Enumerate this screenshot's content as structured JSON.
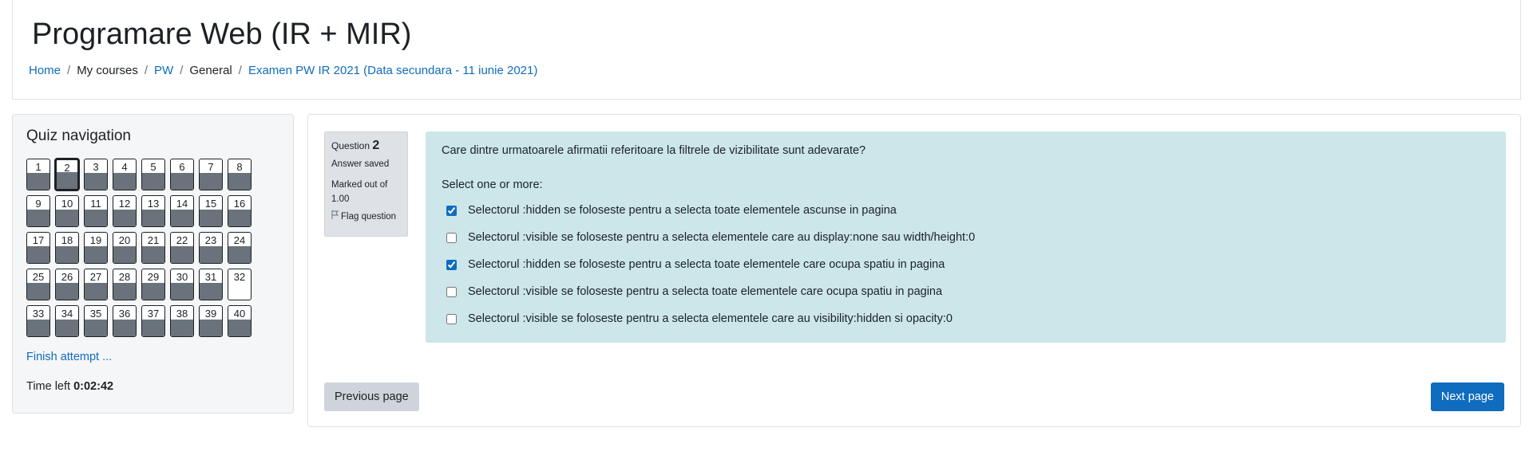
{
  "header": {
    "title": "Programare Web (IR + MIR)",
    "breadcrumb": [
      {
        "label": "Home",
        "link": true
      },
      {
        "label": "My courses",
        "link": false
      },
      {
        "label": "PW",
        "link": true
      },
      {
        "label": "General",
        "link": false
      },
      {
        "label": "Examen PW IR 2021 (Data secundara - 11 iunie 2021)",
        "link": true
      }
    ]
  },
  "quiz_nav": {
    "title": "Quiz navigation",
    "current": 2,
    "questions": [
      {
        "n": "1",
        "answered": true
      },
      {
        "n": "2",
        "answered": true
      },
      {
        "n": "3",
        "answered": true
      },
      {
        "n": "4",
        "answered": true
      },
      {
        "n": "5",
        "answered": true
      },
      {
        "n": "6",
        "answered": true
      },
      {
        "n": "7",
        "answered": true
      },
      {
        "n": "8",
        "answered": true
      },
      {
        "n": "9",
        "answered": true
      },
      {
        "n": "10",
        "answered": true
      },
      {
        "n": "11",
        "answered": true
      },
      {
        "n": "12",
        "answered": true
      },
      {
        "n": "13",
        "answered": true
      },
      {
        "n": "14",
        "answered": true
      },
      {
        "n": "15",
        "answered": true
      },
      {
        "n": "16",
        "answered": true
      },
      {
        "n": "17",
        "answered": true
      },
      {
        "n": "18",
        "answered": true
      },
      {
        "n": "19",
        "answered": true
      },
      {
        "n": "20",
        "answered": true
      },
      {
        "n": "21",
        "answered": true
      },
      {
        "n": "22",
        "answered": true
      },
      {
        "n": "23",
        "answered": true
      },
      {
        "n": "24",
        "answered": true
      },
      {
        "n": "25",
        "answered": true
      },
      {
        "n": "26",
        "answered": true
      },
      {
        "n": "27",
        "answered": true
      },
      {
        "n": "28",
        "answered": true
      },
      {
        "n": "29",
        "answered": true
      },
      {
        "n": "30",
        "answered": true
      },
      {
        "n": "31",
        "answered": true
      },
      {
        "n": "32",
        "answered": false
      },
      {
        "n": "33",
        "answered": true
      },
      {
        "n": "34",
        "answered": true
      },
      {
        "n": "35",
        "answered": true
      },
      {
        "n": "36",
        "answered": true
      },
      {
        "n": "37",
        "answered": true
      },
      {
        "n": "38",
        "answered": true
      },
      {
        "n": "39",
        "answered": true
      },
      {
        "n": "40",
        "answered": true
      }
    ],
    "finish_label": "Finish attempt ...",
    "time_left_label": "Time left",
    "time_left_value": "0:02:42"
  },
  "question": {
    "label": "Question",
    "number": "2",
    "state": "Answer saved",
    "grade": "Marked out of 1.00",
    "flag_label": "Flag question",
    "text": "Care dintre urmatoarele afirmatii referitoare la filtrele de vizibilitate sunt adevarate?",
    "prompt": "Select one or more:",
    "answers": [
      {
        "label": "Selectorul :hidden se foloseste pentru a selecta toate elementele ascunse in pagina",
        "checked": true
      },
      {
        "label": "Selectorul :visible se foloseste pentru a selecta elementele care au display:none sau width/height:0",
        "checked": false
      },
      {
        "label": "Selectorul :hidden se foloseste pentru a selecta toate elementele care ocupa spatiu in pagina",
        "checked": true
      },
      {
        "label": "Selectorul :visible se foloseste pentru a selecta toate elementele care ocupa spatiu in pagina",
        "checked": false
      },
      {
        "label": "Selectorul :visible se foloseste pentru a selecta elementele care au visibility:hidden si opacity:0",
        "checked": false
      }
    ]
  },
  "nav_buttons": {
    "previous": "Previous page",
    "next": "Next page"
  }
}
